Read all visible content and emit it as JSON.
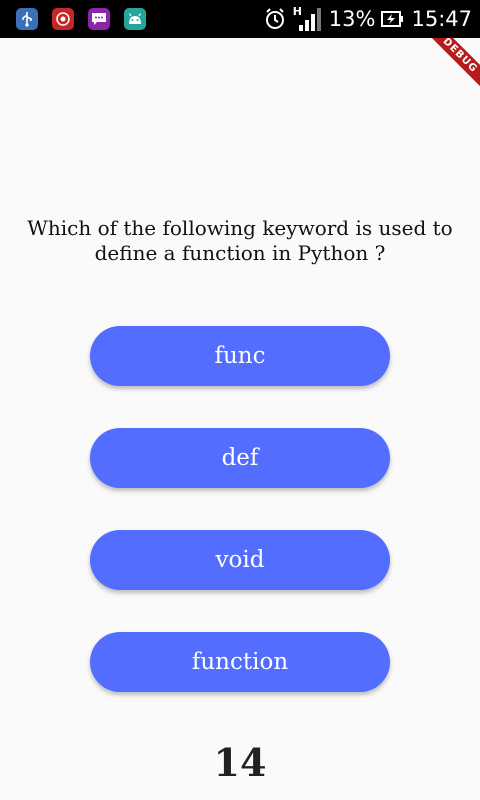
{
  "status_bar": {
    "battery_percent": "13%",
    "time": "15:47",
    "network_type": "H",
    "notification_icons": [
      "usb-icon",
      "screen-recorder-icon",
      "message-icon",
      "android-icon"
    ]
  },
  "debug_banner": {
    "label": "DEBUG"
  },
  "quiz": {
    "question": "Which of the following keyword is used to define a function in Python ?",
    "options": [
      "func",
      "def",
      "void",
      "function"
    ],
    "counter": "14"
  },
  "colors": {
    "button_background": "#536dfe",
    "button_text": "#ffffff",
    "page_background": "#fafafa",
    "status_bar_background": "#000000",
    "debug_banner": "#b71c1c"
  }
}
